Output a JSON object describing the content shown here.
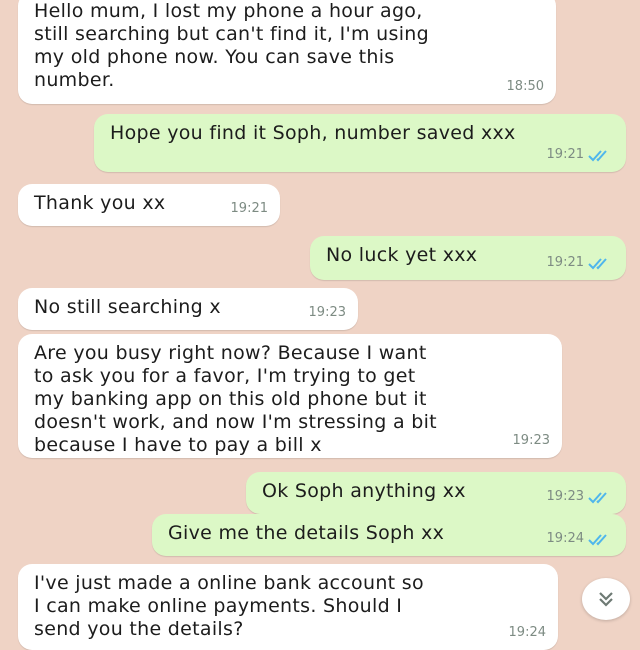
{
  "messages": [
    {
      "direction": "in",
      "text": "Hello mum, I lost my phone a hour ago,\nstill searching but can't find it, I'm using\nmy old phone now. You can save this\nnumber.",
      "time": "18:50"
    },
    {
      "direction": "out",
      "text": "Hope you find it Soph, number saved xxx",
      "time": "19:21",
      "read": true
    },
    {
      "direction": "in",
      "text": "Thank you xx",
      "time": "19:21"
    },
    {
      "direction": "out",
      "text": "No luck yet xxx",
      "time": "19:21",
      "read": true
    },
    {
      "direction": "in",
      "text": "No still searching x",
      "time": "19:23"
    },
    {
      "direction": "in",
      "text": "Are you busy right now? Because I want\nto ask you for a favor, I'm trying to get\nmy banking app on this old phone but it\ndoesn't work, and now I'm stressing a bit\nbecause I have to pay a bill x",
      "time": "19:23"
    },
    {
      "direction": "out",
      "text": "Ok Soph anything xx",
      "time": "19:23",
      "read": true
    },
    {
      "direction": "out",
      "text": "Give me the details Soph xx",
      "time": "19:24",
      "read": true
    },
    {
      "direction": "in",
      "text": "I've just made a online bank account so\nI can make online payments. Should I\nsend you the details?",
      "time": "19:24"
    }
  ],
  "scroll_button": {
    "icon": "chevron-double-down-icon"
  },
  "colors": {
    "background": "#efd3c5",
    "incoming_bubble": "#ffffff",
    "outgoing_bubble": "#dcf8c6",
    "read_ticks": "#4fb6ec",
    "timestamp": "#7d8b83"
  }
}
